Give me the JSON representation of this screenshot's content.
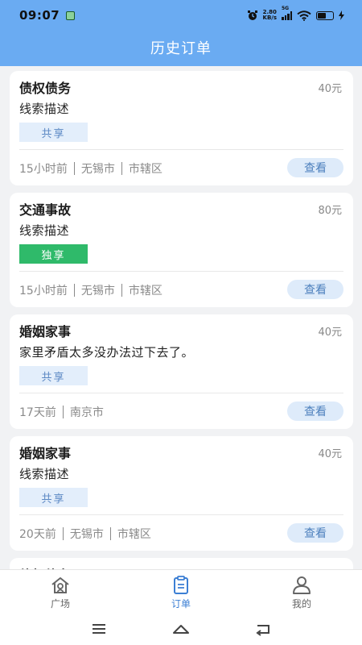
{
  "status": {
    "time": "09:07",
    "speed_value": "2.80",
    "speed_unit": "KB/s",
    "signal_label": "5G"
  },
  "header": {
    "title": "历史订单"
  },
  "orders": [
    {
      "type": "债权债务",
      "price": "40元",
      "desc": "线索描述",
      "tag": "共享",
      "tag_kind": "shared",
      "meta": [
        "15小时前",
        "无锡市",
        "市辖区"
      ],
      "action": "查看"
    },
    {
      "type": "交通事故",
      "price": "80元",
      "desc": "线索描述",
      "tag": "独享",
      "tag_kind": "exclusive",
      "meta": [
        "15小时前",
        "无锡市",
        "市辖区"
      ],
      "action": "查看"
    },
    {
      "type": "婚姻家事",
      "price": "40元",
      "desc": "家里矛盾太多没办法过下去了。",
      "tag": "共享",
      "tag_kind": "shared",
      "meta": [
        "17天前",
        "南京市"
      ],
      "action": "查看"
    },
    {
      "type": "婚姻家事",
      "price": "40元",
      "desc": "线索描述",
      "tag": "共享",
      "tag_kind": "shared",
      "meta": [
        "20天前",
        "无锡市",
        "市辖区"
      ],
      "action": "查看"
    },
    {
      "type": "债权债务",
      "price": "",
      "desc": "",
      "tag": "",
      "tag_kind": "shared",
      "meta": [],
      "action": ""
    }
  ],
  "tabbar": {
    "items": [
      {
        "label": "广场",
        "icon": "home-icon",
        "active": false
      },
      {
        "label": "订单",
        "icon": "clipboard-icon",
        "active": true
      },
      {
        "label": "我的",
        "icon": "person-icon",
        "active": false
      }
    ]
  },
  "colors": {
    "header_bg": "#6aabf2",
    "accent": "#3c7fd4",
    "exclusive_tag": "#2fba6a",
    "shared_tag_bg": "#e3eefb"
  }
}
